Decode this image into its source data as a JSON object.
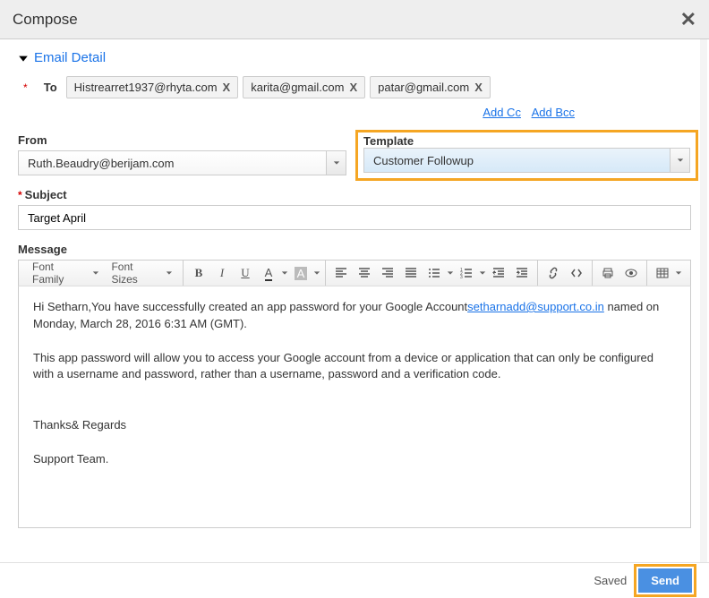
{
  "header": {
    "title": "Compose"
  },
  "section": {
    "title": "Email Detail"
  },
  "to": {
    "label": "To",
    "chips": [
      "Histrearret1937@rhyta.com",
      "karita@gmail.com",
      "patar@gmail.com"
    ]
  },
  "cc": {
    "add_cc": "Add Cc",
    "add_bcc": "Add Bcc"
  },
  "from": {
    "label": "From",
    "value": "Ruth.Beaudry@berijam.com"
  },
  "template": {
    "label": "Template",
    "value": "Customer Followup"
  },
  "subject": {
    "label": "Subject",
    "value": "Target April"
  },
  "message": {
    "label": "Message"
  },
  "toolbar": {
    "font_family": "Font Family",
    "font_sizes": "Font Sizes"
  },
  "body": {
    "p1a": "Hi Setharn,You have successfully created an app password for your Google Account",
    "link": "setharnadd@support.co.in",
    "p1b": " named on Monday, March 28, 2016 6:31 AM (GMT).",
    "p2": "This app password will allow you to access your Google account from a device or application that can only be configured with a username and password, rather than a username, password and a verification code.",
    "p3": "Thanks& Regards",
    "p4": "Support Team."
  },
  "footer": {
    "saved": "Saved",
    "send": "Send"
  }
}
